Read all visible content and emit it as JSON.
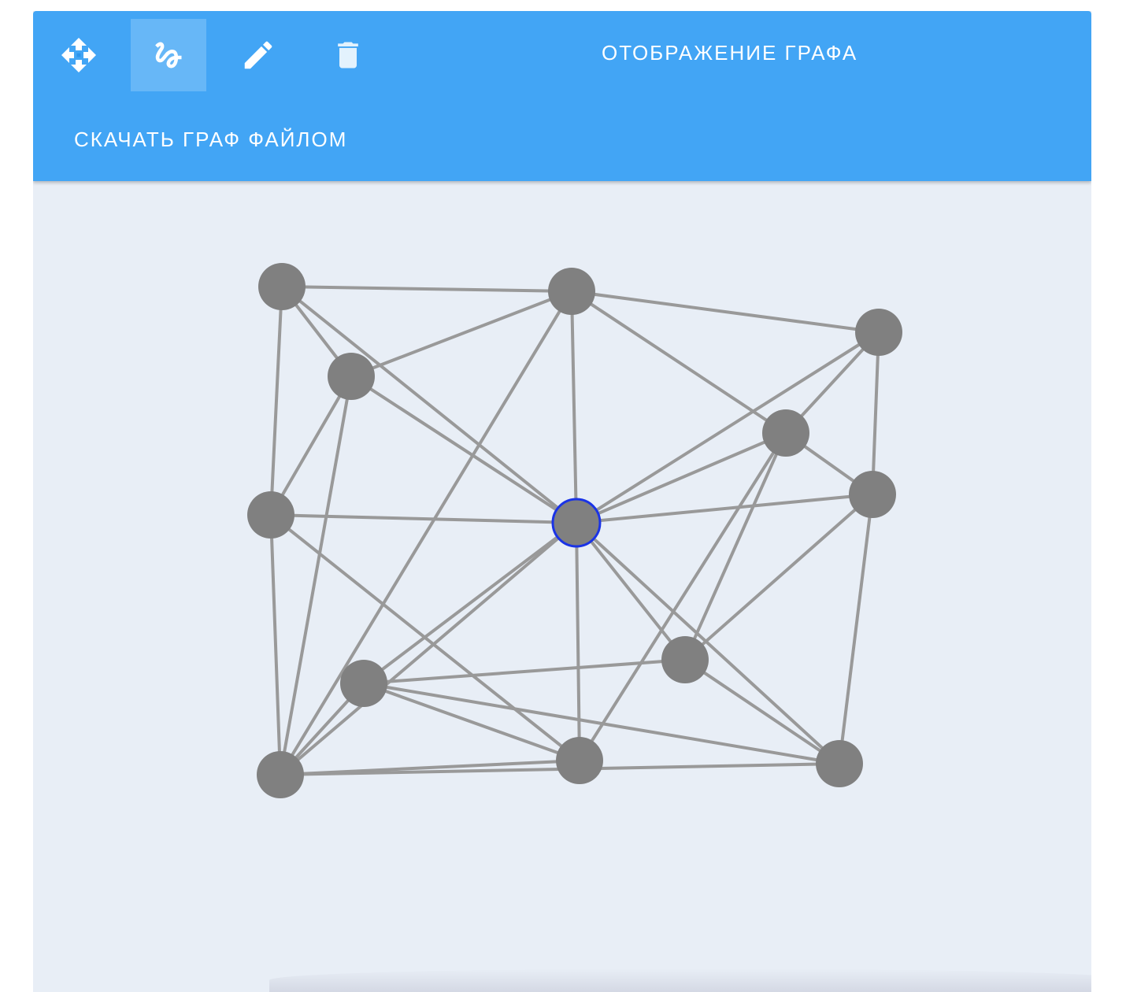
{
  "toolbar": {
    "title": "ОТОБРАЖЕНИЕ ГРАФА",
    "download_label": "СКАЧАТЬ ГРАФ ФАЙЛОМ",
    "tools": [
      {
        "name": "move-tool",
        "icon": "move-icon",
        "active": false
      },
      {
        "name": "draw-edge-tool",
        "icon": "gesture-icon",
        "active": true
      },
      {
        "name": "edit-tool",
        "icon": "pencil-icon",
        "active": false
      },
      {
        "name": "delete-tool",
        "icon": "trash-icon",
        "active": false
      }
    ],
    "colors": {
      "background": "#42a5f5",
      "text": "#ffffff"
    }
  },
  "graph": {
    "colors": {
      "node": "#808080",
      "edge": "#999999",
      "selected_stroke": "#1a33e6",
      "canvas": "#e8eef6"
    },
    "selected_node": 6,
    "nodes": [
      {
        "id": 0
      },
      {
        "id": 1
      },
      {
        "id": 2
      },
      {
        "id": 3
      },
      {
        "id": 4
      },
      {
        "id": 5
      },
      {
        "id": 6
      },
      {
        "id": 7
      },
      {
        "id": 8
      },
      {
        "id": 9
      },
      {
        "id": 10
      },
      {
        "id": 11
      },
      {
        "id": 12
      },
      {
        "id": 13
      }
    ],
    "edges": [
      [
        0,
        1
      ],
      [
        0,
        3
      ],
      [
        0,
        5
      ],
      [
        0,
        6
      ],
      [
        1,
        3
      ],
      [
        1,
        2
      ],
      [
        1,
        4
      ],
      [
        1,
        6
      ],
      [
        1,
        10
      ],
      [
        2,
        4
      ],
      [
        2,
        6
      ],
      [
        2,
        7
      ],
      [
        3,
        6
      ],
      [
        3,
        10
      ],
      [
        3,
        5
      ],
      [
        4,
        7
      ],
      [
        4,
        6
      ],
      [
        4,
        9
      ],
      [
        4,
        11
      ],
      [
        5,
        6
      ],
      [
        5,
        10
      ],
      [
        5,
        11
      ],
      [
        6,
        7
      ],
      [
        6,
        9
      ],
      [
        6,
        10
      ],
      [
        6,
        11
      ],
      [
        6,
        12
      ],
      [
        6,
        13
      ],
      [
        7,
        9
      ],
      [
        7,
        13
      ],
      [
        8,
        9
      ],
      [
        8,
        12
      ],
      [
        8,
        13
      ],
      [
        9,
        13
      ],
      [
        10,
        11
      ],
      [
        10,
        12
      ],
      [
        10,
        13
      ],
      [
        11,
        12
      ]
    ]
  }
}
